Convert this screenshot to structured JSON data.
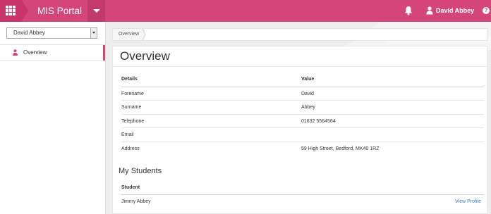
{
  "app": {
    "title": "MIS Portal",
    "accent": "#d44679",
    "user_name": "David Abbey",
    "help_label": "?"
  },
  "icons": {
    "apps": "grid-icon",
    "menu": "chevron-down-icon",
    "notifications": "bell-icon",
    "user": "user-icon",
    "help": "help-icon"
  },
  "sidebar": {
    "selected_person": "David Abbey",
    "items": [
      {
        "label": "Overview",
        "active": true
      }
    ]
  },
  "breadcrumb": [
    "Overview"
  ],
  "main": {
    "title": "Overview",
    "details_table": {
      "headers": [
        "Details",
        "Value"
      ],
      "rows": [
        [
          "Forename",
          "David"
        ],
        [
          "Surname",
          "Abbey"
        ],
        [
          "Telephone",
          "01632 5564564"
        ],
        [
          "Email",
          ""
        ],
        [
          "Address",
          "59 High Street, Bedford, MK40 1RZ"
        ]
      ]
    },
    "students_title": "My Students",
    "students_table": {
      "headers": [
        "Student"
      ],
      "rows": [
        {
          "name": "Jimmy Abbey",
          "action": "View Profile",
          "link_color": "#3a7bbf"
        }
      ]
    }
  }
}
